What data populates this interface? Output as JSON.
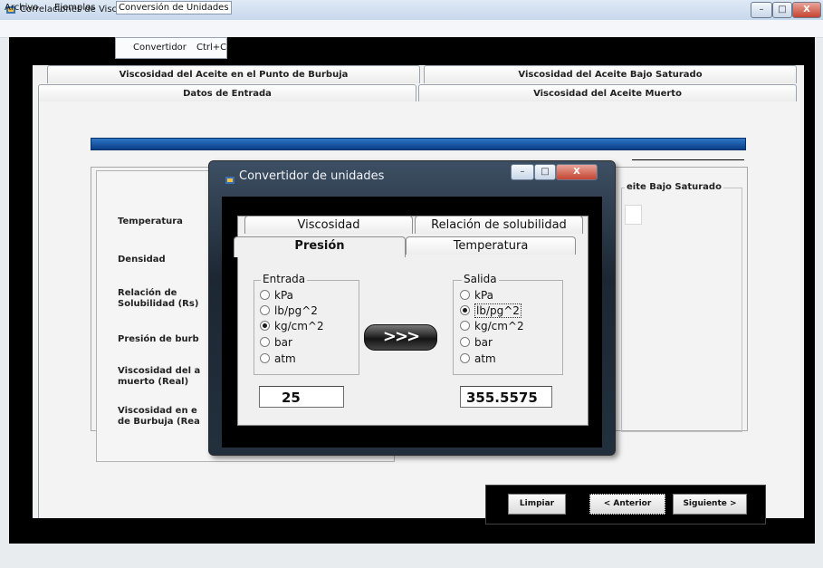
{
  "window": {
    "title": "Correlaciones de Viscosidad",
    "minimize": "–",
    "maximize": "□",
    "close": "X"
  },
  "menu": {
    "items": [
      "Archivo",
      "Ejemplos",
      "Conversión de Unidades"
    ],
    "dropdown": {
      "label": "Convertidor",
      "shortcut": "Ctrl+C"
    }
  },
  "main_tabs": {
    "top_row": [
      "Viscosidad del Aceite en el Punto de Burbuja",
      "Viscosidad del Aceite Bajo Saturado"
    ],
    "bottom_row": [
      "Datos de Entrada",
      "Viscosidad del Aceite Muerto"
    ]
  },
  "fields": {
    "temperatura": "Temperatura",
    "densidad": "Densidad",
    "relacion": "Relación de Solubilidad (Rs)",
    "presion": "Presión de burb",
    "visc_muerto": "Viscosidad del a muerto (Real)",
    "visc_burbuja": "Viscosidad en e de Burbuja (Rea"
  },
  "right_group": {
    "title": "eite Bajo Saturado"
  },
  "buttons": {
    "limpiar": "Limpiar",
    "anterior": "< Anterior",
    "siguiente": "Siguiente >"
  },
  "dialog": {
    "title": "Convertidor de unidades",
    "minimize": "–",
    "maximize": "□",
    "close": "X",
    "tabs_back": [
      "Viscosidad",
      "Relación de solubilidad"
    ],
    "tabs_front": [
      "Presión",
      "Temperatura"
    ],
    "entrada": {
      "title": "Entrada",
      "options": [
        "kPa",
        "lb/pg^2",
        "kg/cm^2",
        "bar",
        "atm"
      ],
      "selected": "kg/cm^2",
      "value": "25"
    },
    "salida": {
      "title": "Salida",
      "options": [
        "kPa",
        "lb/pg^2",
        "kg/cm^2",
        "bar",
        "atm"
      ],
      "selected": "lb/pg^2",
      "value": "355.5575"
    },
    "convert_label": ">>>"
  }
}
